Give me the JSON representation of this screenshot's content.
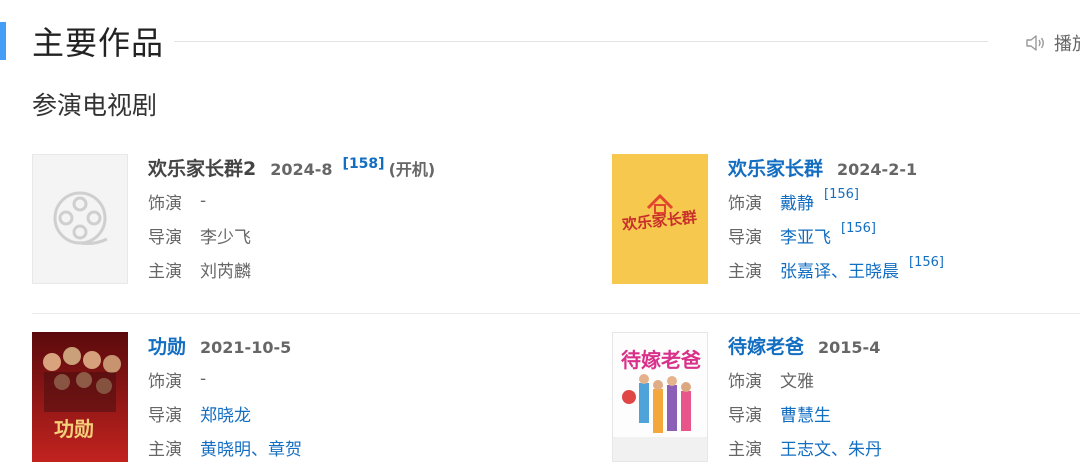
{
  "header": {
    "title": "主要作品",
    "play_label": "播放",
    "accent_color": "#459df5"
  },
  "section": {
    "subtitle": "参演电视剧"
  },
  "works": [
    {
      "title": "欢乐家长群2",
      "date": "2024-8",
      "ref": "[158]",
      "note": "(开机)",
      "role_label": "饰演",
      "role": "-",
      "director_label": "导演",
      "director": "李少飞",
      "cast_label": "主演",
      "cast": "刘芮麟",
      "poster_icon": "film-reel-icon"
    },
    {
      "title": "欢乐家长群",
      "date": "2024-2-1",
      "role_label": "饰演",
      "role": "戴静",
      "role_ref": "[156]",
      "director_label": "导演",
      "director": "李亚飞",
      "director_ref": "[156]",
      "cast_label": "主演",
      "cast": [
        "张嘉译",
        "王晓晨"
      ],
      "cast_sep": "、",
      "cast_ref": "[156]",
      "poster_text": "欢乐家长群"
    },
    {
      "title": "功勋",
      "date": "2021-10-5",
      "role_label": "饰演",
      "role": "-",
      "director_label": "导演",
      "director": "郑晓龙",
      "cast_label": "主演",
      "cast": [
        "黄晓明",
        "章贺"
      ],
      "cast_sep": "、",
      "poster_text": "功勋"
    },
    {
      "title": "待嫁老爸",
      "date": "2015-4",
      "role_label": "饰演",
      "role": "文雅",
      "director_label": "导演",
      "director": "曹慧生",
      "cast_label": "主演",
      "cast": [
        "王志文",
        "朱丹"
      ],
      "cast_sep": "、",
      "poster_text": "待嫁老爸"
    }
  ],
  "colors": {
    "link": "#136ec2",
    "label": "#666666",
    "poster_yellow": "#f6c94e",
    "poster_red": "#a3171a"
  }
}
